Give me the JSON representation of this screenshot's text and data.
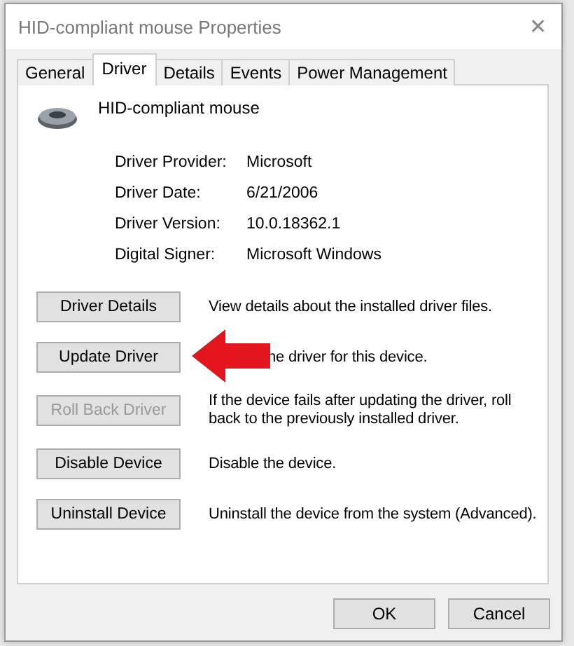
{
  "window": {
    "title": "HID-compliant mouse Properties",
    "close": "✕"
  },
  "tabs": [
    {
      "label": "General",
      "selected": false
    },
    {
      "label": "Driver",
      "selected": true
    },
    {
      "label": "Details",
      "selected": false
    },
    {
      "label": "Events",
      "selected": false
    },
    {
      "label": "Power Management",
      "selected": false
    }
  ],
  "device": {
    "name": "HID-compliant mouse"
  },
  "info": [
    {
      "label": "Driver Provider:",
      "value": "Microsoft"
    },
    {
      "label": "Driver Date:",
      "value": "6/21/2006"
    },
    {
      "label": "Driver Version:",
      "value": "10.0.18362.1"
    },
    {
      "label": "Digital Signer:",
      "value": "Microsoft Windows"
    }
  ],
  "actions": [
    {
      "label": "Driver Details",
      "description": "View details about the installed driver files.",
      "disabled": false,
      "highlighted": false
    },
    {
      "label": "Update Driver",
      "description": "he driver for this device.",
      "disabled": false,
      "highlighted": true
    },
    {
      "label": "Roll Back Driver",
      "description": "If the device fails after updating the driver, roll back to the previously installed driver.",
      "disabled": true,
      "highlighted": false
    },
    {
      "label": "Disable Device",
      "description": "Disable the device.",
      "disabled": false,
      "highlighted": false
    },
    {
      "label": "Uninstall Device",
      "description": "Uninstall the device from the system (Advanced).",
      "disabled": false,
      "highlighted": false
    }
  ],
  "buttons": [
    "OK",
    "Cancel"
  ]
}
